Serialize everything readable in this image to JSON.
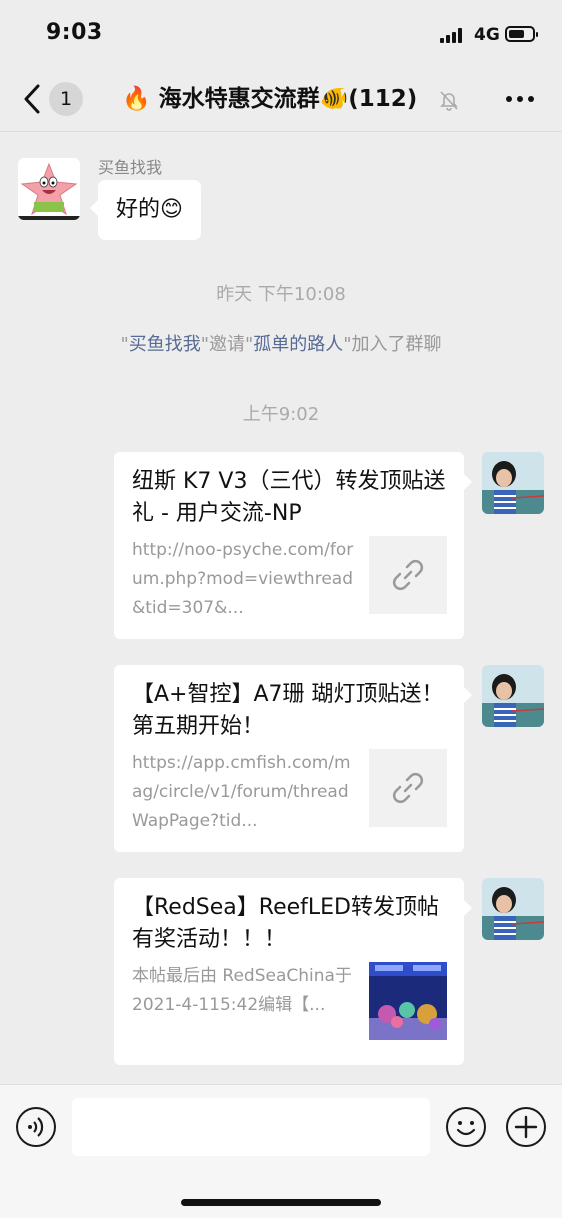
{
  "status_bar": {
    "time": "9:03",
    "network": "4G"
  },
  "nav": {
    "unread_count": "1",
    "title": "🔥 海水特惠交流群🐠(112)"
  },
  "messages": {
    "incoming": {
      "sender": "买鱼找我",
      "text": "好的😊"
    },
    "timestamp_1": "昨天 下午10:08",
    "system": {
      "q1": "\"",
      "inviter": "买鱼找我",
      "mid": "\"邀请\"",
      "invitee": "孤单的路人",
      "tail": "\"加入了群聊"
    },
    "timestamp_2": "上午9:02",
    "cards": [
      {
        "title": "纽斯 K7 V3（三代）转发顶贴送礼 - 用户交流-NP",
        "desc": "http://noo-psyche.com/forum.php?mod=viewthread&tid=307&...",
        "thumb": "link-icon"
      },
      {
        "title": "【A+智控】A7珊 瑚灯顶贴送！第五期开始！",
        "desc": "https://app.cmfish.com/mag/circle/v1/forum/threadWapPage?tid...",
        "thumb": "link-icon"
      },
      {
        "title": "【RedSea】ReefLED转发顶帖有奖活动！！！",
        "desc": "本帖最后由 RedSeaChina于2021-4-115:42编辑【...",
        "thumb": "aquarium-image"
      }
    ]
  },
  "input": {
    "placeholder": ""
  },
  "colors": {
    "background": "#ededed",
    "bubble": "#ffffff",
    "link": "#576b95",
    "meta": "#aaaaaa"
  }
}
